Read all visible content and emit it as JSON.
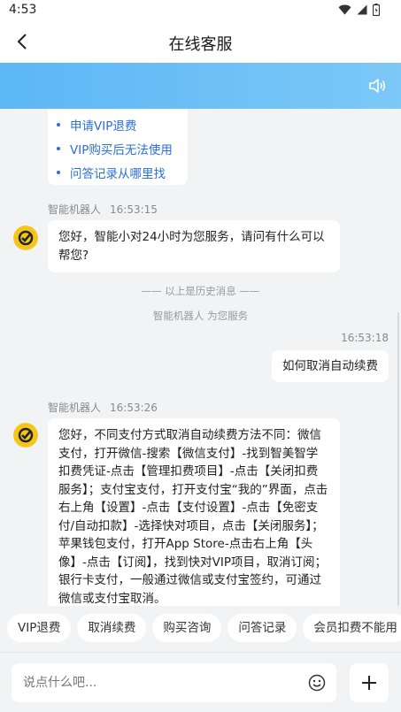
{
  "status_bar": {
    "time": "4:53"
  },
  "header": {
    "title": "在线客服"
  },
  "faq": {
    "items": [
      "申请VIP退费",
      "VIP购买后无法使用",
      "问答记录从哪里找"
    ]
  },
  "messages": [
    {
      "sender": "智能机器人",
      "time": "16:53:15",
      "text": "您好，智能小对24小时为您服务，请问有什么可以帮您?"
    },
    {
      "time": "16:53:18",
      "text": "如何取消自动续费"
    },
    {
      "sender": "智能机器人",
      "time": "16:53:26",
      "text": "您好，不同支付方式取消自动续费方法不同：微信支付，打开微信-搜索【微信支付】-找到智美智学扣费凭证-点击【管理扣费项目】-点击【关闭扣费服务】；支付宝支付，打开支付宝“我的”界面，点击右上角【设置】-点击【支付设置】-点击【免密支付/自动扣款】-选择快对项目，点击【关闭服务】；苹果钱包支付，打开App Store-点击右上角【头像】-点击【订阅】，找到快对VIP项目，取消订阅；银行卡支付，一般通过微信或支付宝签约，可通过微信或支付宝取消。"
    }
  ],
  "history_divider": "—— 以上是历史消息 ——",
  "robot_service": "智能机器人 为您服务",
  "quick_replies": [
    "VIP退费",
    "取消续费",
    "购买咨询",
    "问答记录",
    "会员扣费不能用"
  ],
  "input": {
    "placeholder": "说点什么吧..."
  },
  "colors": {
    "accent": "#2b6fd6",
    "banner": "#5cb7f5",
    "avatar": "#f5c518"
  },
  "icons": {
    "back": "chevron-left-icon",
    "speaker": "speaker-icon",
    "emoji": "smile-icon",
    "plus": "plus-icon",
    "wifi": "wifi-icon",
    "signal": "signal-icon",
    "battery": "battery-icon"
  }
}
